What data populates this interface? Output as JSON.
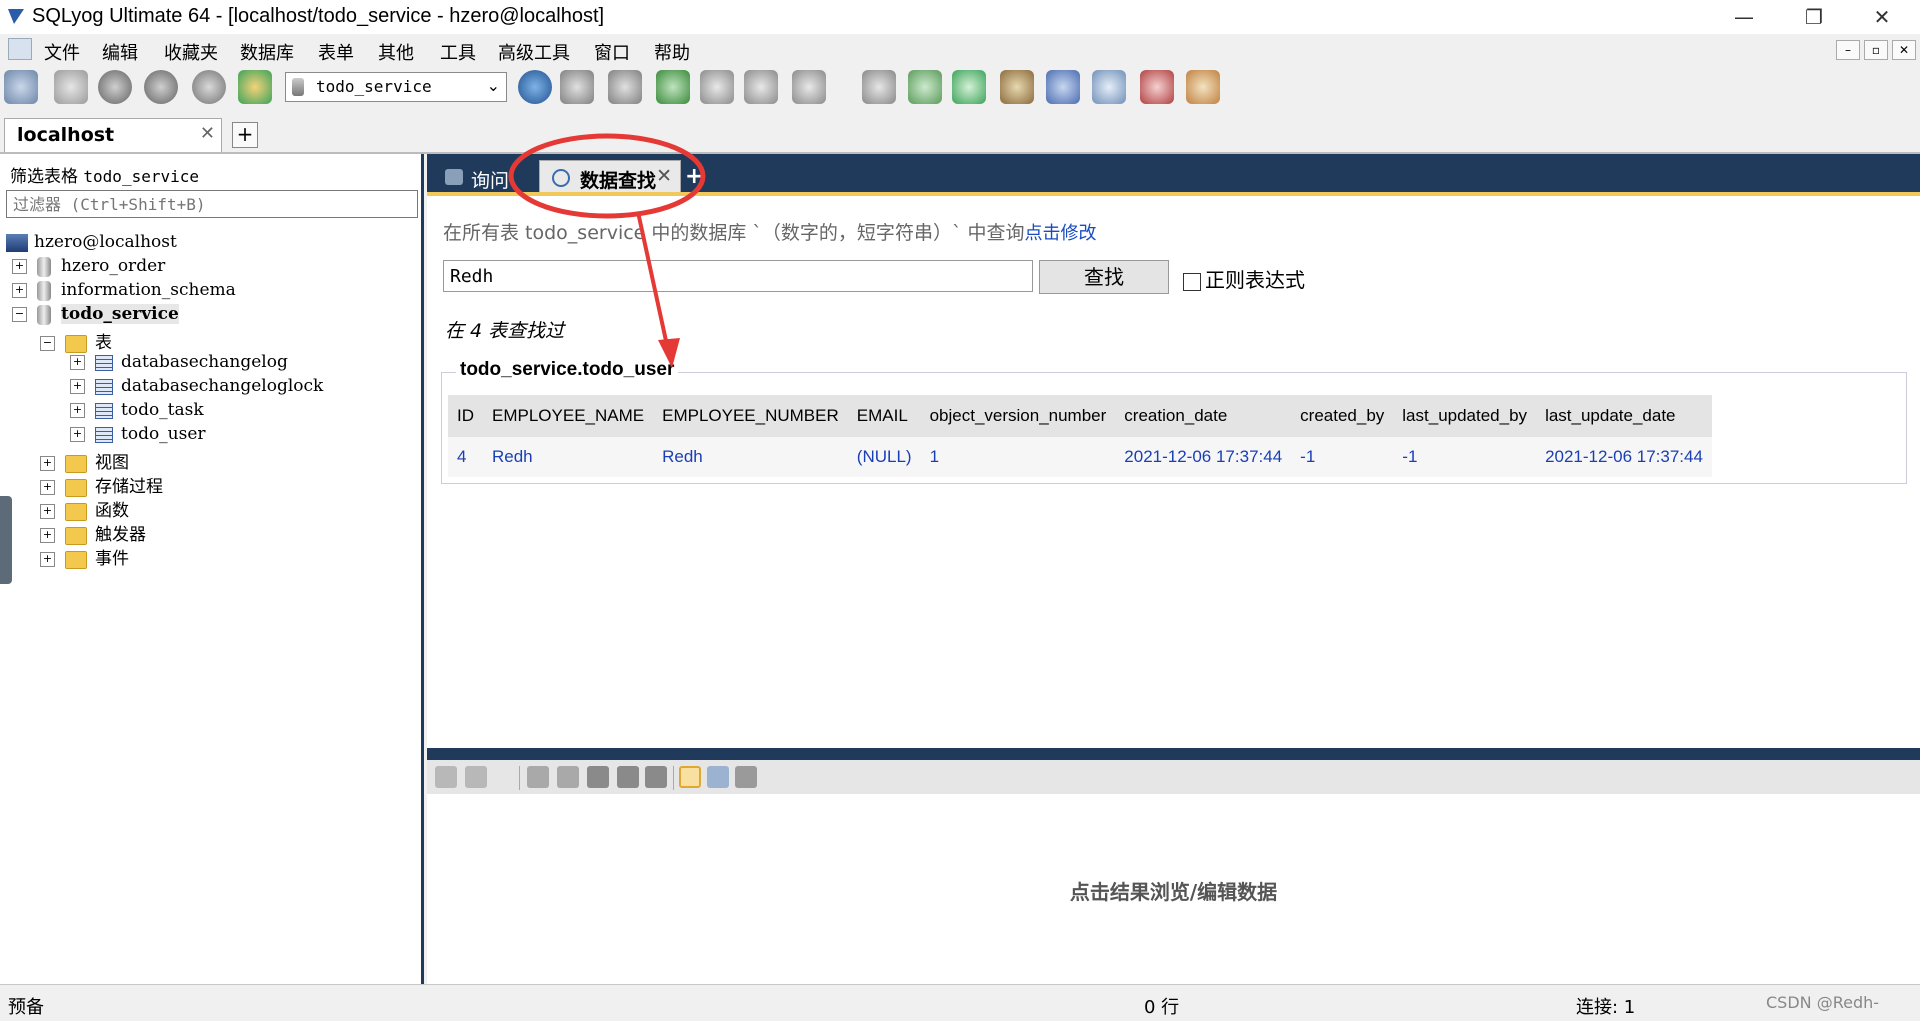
{
  "window": {
    "title": "SQLyog Ultimate 64 - [localhost/todo_service - hzero@localhost]",
    "min": "—",
    "max": "❐",
    "close": "✕"
  },
  "menu": {
    "items": [
      "文件",
      "编辑",
      "收藏夹",
      "数据库",
      "表单",
      "其他",
      "工具",
      "高级工具",
      "窗口",
      "帮助"
    ],
    "mdi": [
      "–",
      "▫",
      "✕"
    ]
  },
  "toolbar": {
    "db_select": "todo_service"
  },
  "connection_tab": {
    "label": "localhost",
    "close": "✕",
    "add": "+"
  },
  "sidebar": {
    "filter_label": "筛选表格",
    "filter_db": "todo_service",
    "filter_placeholder": "过滤器 (Ctrl+Shift+B)",
    "tree": {
      "server": "hzero@localhost",
      "db1": "hzero_order",
      "db2": "information_schema",
      "db3": "todo_service",
      "tables_folder": "表",
      "tables": [
        "databasechangelog",
        "databasechangeloglock",
        "todo_task",
        "todo_user"
      ],
      "folders": [
        "视图",
        "存储过程",
        "函数",
        "触发器",
        "事件"
      ]
    }
  },
  "tabs": {
    "query": "询问",
    "search": "数据查找",
    "close": "✕",
    "add": "+"
  },
  "search": {
    "hint": "在所有表 todo_service 中的数据库 `（数字的，短字符串）` 中查询",
    "hint_link": "点击修改",
    "value": "Redh",
    "button": "查找",
    "regex_label": "正则表达式",
    "searched": "在 4 表查找过"
  },
  "result": {
    "title": "todo_service.todo_user",
    "columns": [
      "ID",
      "EMPLOYEE_NAME",
      "EMPLOYEE_NUMBER",
      "EMAIL",
      "object_version_number",
      "creation_date",
      "created_by",
      "last_updated_by",
      "last_update_date"
    ],
    "rows": [
      [
        "4",
        "Redh",
        "Redh",
        "(NULL)",
        "1",
        "2021-12-06 17:37:44",
        "-1",
        "-1",
        "2021-12-06 17:37:44"
      ]
    ]
  },
  "bottom": {
    "message": "点击结果浏览/编辑数据"
  },
  "status": {
    "left": "预备",
    "rows": "0 行",
    "connections": "连接: 1",
    "watermark": "CSDN @Redh-"
  },
  "colors": {
    "navy": "#1f3a5a",
    "accent": "#f0c95a",
    "link": "#1a4bbf",
    "annotation": "#e53935"
  }
}
